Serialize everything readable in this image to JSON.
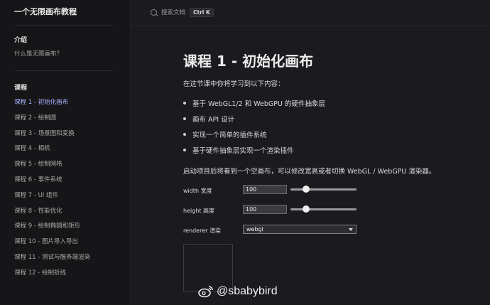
{
  "sidebar": {
    "brand": "一个无限画布教程",
    "intro_heading": "介绍",
    "intro_items": [
      {
        "label": "什么是无限画布？"
      }
    ],
    "course_heading": "课程",
    "course_items": [
      {
        "label": "课程 1 - 初始化画布",
        "active": true
      },
      {
        "label": "课程 2 - 绘制圆"
      },
      {
        "label": "课程 3 - 场景图和变换"
      },
      {
        "label": "课程 4 - 相机"
      },
      {
        "label": "课程 5 - 绘制网格"
      },
      {
        "label": "课程 6 - 事件系统"
      },
      {
        "label": "课程 7 - UI 组件"
      },
      {
        "label": "课程 8 - 性能优化"
      },
      {
        "label": "课程 9 - 绘制椭圆和矩形"
      },
      {
        "label": "课程 10 - 图片导入导出"
      },
      {
        "label": "课程 11 - 测试与服务端渲染"
      },
      {
        "label": "课程 12 - 绘制折线"
      }
    ],
    "active_color": "#a8b1ff"
  },
  "search": {
    "placeholder": "搜索文档",
    "shortcut": "Ctrl K"
  },
  "main": {
    "title": "课程 1 - 初始化画布",
    "intro": "在这节课中你将学习到以下内容：",
    "bullets": [
      "基于 WebGL1/2 和 WebGPU 的硬件抽象层",
      "画布 API 设计",
      "实现一个简单的插件系统",
      "基于硬件抽象层实现一个渲染插件"
    ],
    "description": "启动项目后将看到一个空画布，可以修改宽高或者切换 WebGL / WebGPU 渲染器。",
    "controls": {
      "width_label": "width 宽度",
      "width_value": "100",
      "width_slider_fraction": 0.2,
      "height_label": "height 高度",
      "height_value": "100",
      "height_slider_fraction": 0.2,
      "renderer_label": "renderer 渲染",
      "renderer_value": "webgl"
    }
  },
  "watermark": "@sbabybird"
}
